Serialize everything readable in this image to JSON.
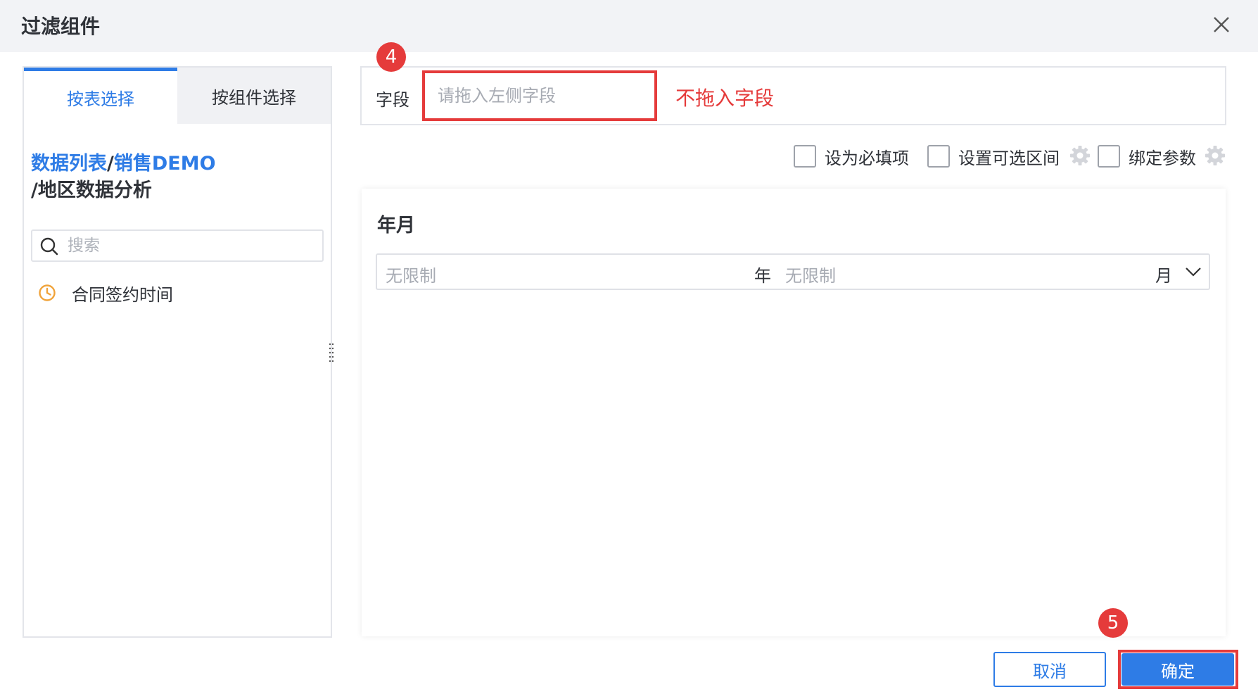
{
  "dialog": {
    "title": "过滤组件"
  },
  "left": {
    "tabs": [
      {
        "label": "按表选择",
        "active": true
      },
      {
        "label": "按组件选择",
        "active": false
      }
    ],
    "breadcrumb": {
      "part1": "数据列表",
      "sep1": "/",
      "part2": "销售DEMO",
      "line2": "/地区数据分析"
    },
    "search": {
      "placeholder": "搜索",
      "value": ""
    },
    "fields": [
      {
        "label": "合同签约时间",
        "icon": "clock-icon"
      }
    ]
  },
  "field": {
    "label": "字段",
    "placeholder": "请拖入左侧字段",
    "value": "",
    "annotation": "不拖入字段"
  },
  "badges": {
    "step4": "4",
    "step5": "5"
  },
  "options": [
    {
      "label": "设为必填项",
      "checked": false
    },
    {
      "label": "设置可选区间",
      "checked": false
    },
    {
      "label": "绑定参数",
      "checked": false
    }
  ],
  "preview": {
    "title": "年月",
    "year_placeholder": "无限制",
    "year_unit": "年",
    "month_placeholder": "无限制",
    "month_unit": "月"
  },
  "buttons": {
    "cancel": "取消",
    "ok": "确定"
  },
  "colors": {
    "accent": "#2e7ce6",
    "highlight": "#e53b3b",
    "clock": "#f0a33a"
  }
}
